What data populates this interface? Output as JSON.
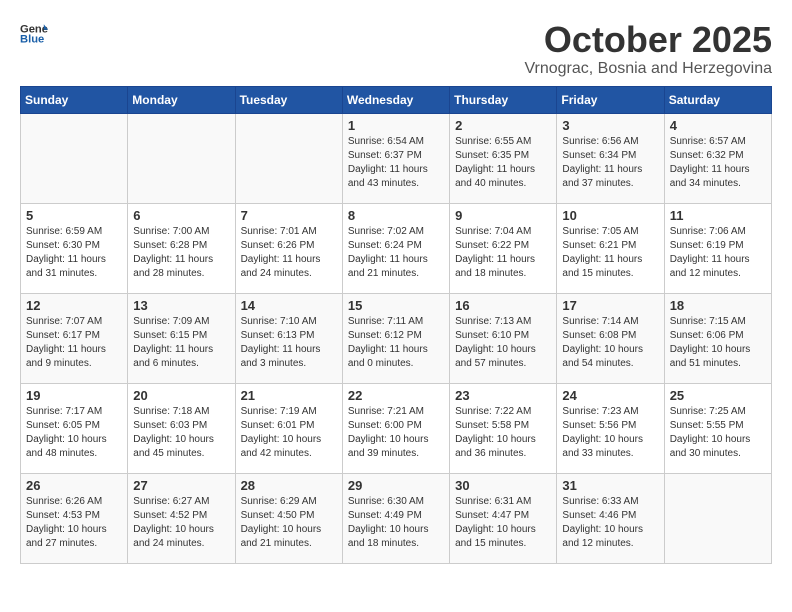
{
  "header": {
    "logo_general": "General",
    "logo_blue": "Blue",
    "month": "October 2025",
    "location": "Vrnograc, Bosnia and Herzegovina"
  },
  "days_of_week": [
    "Sunday",
    "Monday",
    "Tuesday",
    "Wednesday",
    "Thursday",
    "Friday",
    "Saturday"
  ],
  "weeks": [
    [
      {
        "day": "",
        "info": ""
      },
      {
        "day": "",
        "info": ""
      },
      {
        "day": "",
        "info": ""
      },
      {
        "day": "1",
        "info": "Sunrise: 6:54 AM\nSunset: 6:37 PM\nDaylight: 11 hours\nand 43 minutes."
      },
      {
        "day": "2",
        "info": "Sunrise: 6:55 AM\nSunset: 6:35 PM\nDaylight: 11 hours\nand 40 minutes."
      },
      {
        "day": "3",
        "info": "Sunrise: 6:56 AM\nSunset: 6:34 PM\nDaylight: 11 hours\nand 37 minutes."
      },
      {
        "day": "4",
        "info": "Sunrise: 6:57 AM\nSunset: 6:32 PM\nDaylight: 11 hours\nand 34 minutes."
      }
    ],
    [
      {
        "day": "5",
        "info": "Sunrise: 6:59 AM\nSunset: 6:30 PM\nDaylight: 11 hours\nand 31 minutes."
      },
      {
        "day": "6",
        "info": "Sunrise: 7:00 AM\nSunset: 6:28 PM\nDaylight: 11 hours\nand 28 minutes."
      },
      {
        "day": "7",
        "info": "Sunrise: 7:01 AM\nSunset: 6:26 PM\nDaylight: 11 hours\nand 24 minutes."
      },
      {
        "day": "8",
        "info": "Sunrise: 7:02 AM\nSunset: 6:24 PM\nDaylight: 11 hours\nand 21 minutes."
      },
      {
        "day": "9",
        "info": "Sunrise: 7:04 AM\nSunset: 6:22 PM\nDaylight: 11 hours\nand 18 minutes."
      },
      {
        "day": "10",
        "info": "Sunrise: 7:05 AM\nSunset: 6:21 PM\nDaylight: 11 hours\nand 15 minutes."
      },
      {
        "day": "11",
        "info": "Sunrise: 7:06 AM\nSunset: 6:19 PM\nDaylight: 11 hours\nand 12 minutes."
      }
    ],
    [
      {
        "day": "12",
        "info": "Sunrise: 7:07 AM\nSunset: 6:17 PM\nDaylight: 11 hours\nand 9 minutes."
      },
      {
        "day": "13",
        "info": "Sunrise: 7:09 AM\nSunset: 6:15 PM\nDaylight: 11 hours\nand 6 minutes."
      },
      {
        "day": "14",
        "info": "Sunrise: 7:10 AM\nSunset: 6:13 PM\nDaylight: 11 hours\nand 3 minutes."
      },
      {
        "day": "15",
        "info": "Sunrise: 7:11 AM\nSunset: 6:12 PM\nDaylight: 11 hours\nand 0 minutes."
      },
      {
        "day": "16",
        "info": "Sunrise: 7:13 AM\nSunset: 6:10 PM\nDaylight: 10 hours\nand 57 minutes."
      },
      {
        "day": "17",
        "info": "Sunrise: 7:14 AM\nSunset: 6:08 PM\nDaylight: 10 hours\nand 54 minutes."
      },
      {
        "day": "18",
        "info": "Sunrise: 7:15 AM\nSunset: 6:06 PM\nDaylight: 10 hours\nand 51 minutes."
      }
    ],
    [
      {
        "day": "19",
        "info": "Sunrise: 7:17 AM\nSunset: 6:05 PM\nDaylight: 10 hours\nand 48 minutes."
      },
      {
        "day": "20",
        "info": "Sunrise: 7:18 AM\nSunset: 6:03 PM\nDaylight: 10 hours\nand 45 minutes."
      },
      {
        "day": "21",
        "info": "Sunrise: 7:19 AM\nSunset: 6:01 PM\nDaylight: 10 hours\nand 42 minutes."
      },
      {
        "day": "22",
        "info": "Sunrise: 7:21 AM\nSunset: 6:00 PM\nDaylight: 10 hours\nand 39 minutes."
      },
      {
        "day": "23",
        "info": "Sunrise: 7:22 AM\nSunset: 5:58 PM\nDaylight: 10 hours\nand 36 minutes."
      },
      {
        "day": "24",
        "info": "Sunrise: 7:23 AM\nSunset: 5:56 PM\nDaylight: 10 hours\nand 33 minutes."
      },
      {
        "day": "25",
        "info": "Sunrise: 7:25 AM\nSunset: 5:55 PM\nDaylight: 10 hours\nand 30 minutes."
      }
    ],
    [
      {
        "day": "26",
        "info": "Sunrise: 6:26 AM\nSunset: 4:53 PM\nDaylight: 10 hours\nand 27 minutes."
      },
      {
        "day": "27",
        "info": "Sunrise: 6:27 AM\nSunset: 4:52 PM\nDaylight: 10 hours\nand 24 minutes."
      },
      {
        "day": "28",
        "info": "Sunrise: 6:29 AM\nSunset: 4:50 PM\nDaylight: 10 hours\nand 21 minutes."
      },
      {
        "day": "29",
        "info": "Sunrise: 6:30 AM\nSunset: 4:49 PM\nDaylight: 10 hours\nand 18 minutes."
      },
      {
        "day": "30",
        "info": "Sunrise: 6:31 AM\nSunset: 4:47 PM\nDaylight: 10 hours\nand 15 minutes."
      },
      {
        "day": "31",
        "info": "Sunrise: 6:33 AM\nSunset: 4:46 PM\nDaylight: 10 hours\nand 12 minutes."
      },
      {
        "day": "",
        "info": ""
      }
    ]
  ]
}
